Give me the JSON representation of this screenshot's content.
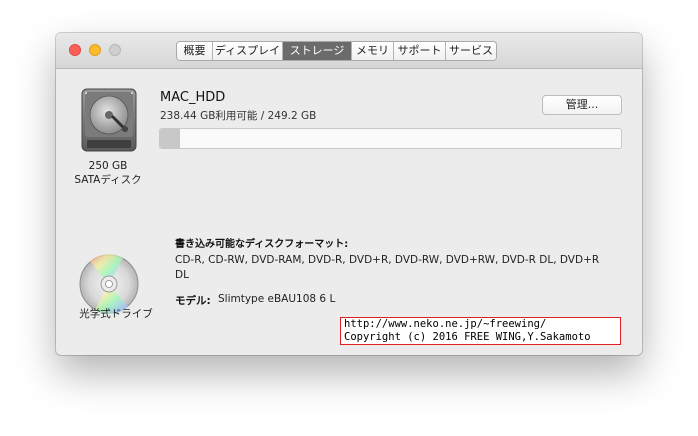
{
  "tabs": [
    {
      "label": "概要",
      "active": false
    },
    {
      "label": "ディスプレイ",
      "active": false
    },
    {
      "label": "ストレージ",
      "active": true
    },
    {
      "label": "メモリ",
      "active": false
    },
    {
      "label": "サポート",
      "active": false
    },
    {
      "label": "サービス",
      "active": false
    }
  ],
  "disk": {
    "size": "250 GB",
    "type": "SATAディスク",
    "icon": "hard-disk-icon",
    "volume_name": "MAC_HDD",
    "availability": "238.44 GB利用可能 / 249.2 GB",
    "used_fraction": 0.043,
    "manage_label": "管理..."
  },
  "optical": {
    "label": "光学式ドライブ",
    "icon": "optical-disc-icon",
    "formats_title": "書き込み可能なディスクフォーマット:",
    "formats": "CD-R, CD-RW, DVD-RAM, DVD-R, DVD+R, DVD-RW, DVD+RW, DVD-R DL, DVD+R DL",
    "model_label": "モデル:",
    "model_value": "Slimtype eBAU108 6 L"
  },
  "credit": {
    "line1": "http://www.neko.ne.jp/~freewing/",
    "line2": "Copyright (c) 2016 FREE WING,Y.Sakamoto"
  },
  "colors": {
    "close": "#fc5f57",
    "minimize": "#fdbc2e",
    "zoom_inactive": "#cfcfcf",
    "active_tab": "#6b6b6b",
    "credit_border": "#e02020"
  }
}
